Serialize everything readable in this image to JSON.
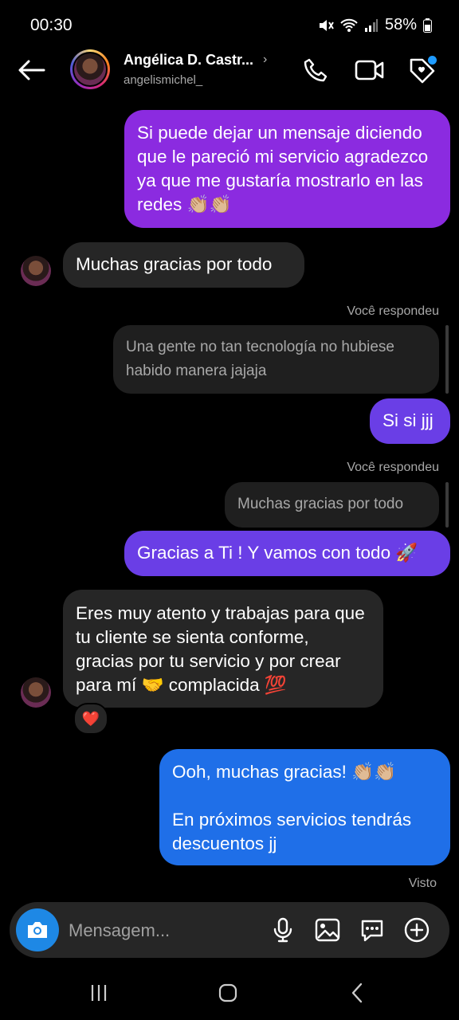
{
  "status_bar": {
    "time": "00:30",
    "battery": "58%"
  },
  "header": {
    "contact_name": "Angélica D. Castr...",
    "username": "angelismichel_",
    "chevron": "›"
  },
  "messages": {
    "m1": "Si puede dejar un mensaje diciendo que le pareció mi servicio agradezco ya que me gustaría mostrarlo en las redes 👏🏼👏🏼",
    "m2": "Muchas gracias por todo",
    "reply1_label": "Você respondeu",
    "reply1_quote": "Una gente no tan tecnología no hubiese habido manera jajaja",
    "m3": "Si si jjj",
    "reply2_label": "Você respondeu",
    "reply2_quote": "Muchas gracias por todo",
    "m4": "Gracias a Ti ! Y vamos con todo 🚀",
    "m5": "Eres muy atento y trabajas para que tu cliente se sienta conforme, gracias por tu servicio y por crear para mí 🤝 complacida 💯",
    "m5_reaction": "❤️",
    "m6_line1": "Ooh, muchas gracias! 👏🏼👏🏼",
    "m6_line2": "En próximos servicios tendrás descuentos jj",
    "seen": "Visto"
  },
  "composer": {
    "placeholder": "Mensagem..."
  },
  "colors": {
    "purple": "#8b2be0",
    "violet": "#6a3ee6",
    "blue": "#1f6fe8",
    "received": "#262626",
    "accent": "#1e88e5"
  },
  "icons": [
    "back-arrow-icon",
    "phone-icon",
    "video-icon",
    "heart-tag-icon",
    "camera-icon",
    "microphone-icon",
    "gallery-icon",
    "sticker-icon",
    "plus-icon",
    "recents-icon",
    "home-icon",
    "nav-back-icon"
  ]
}
